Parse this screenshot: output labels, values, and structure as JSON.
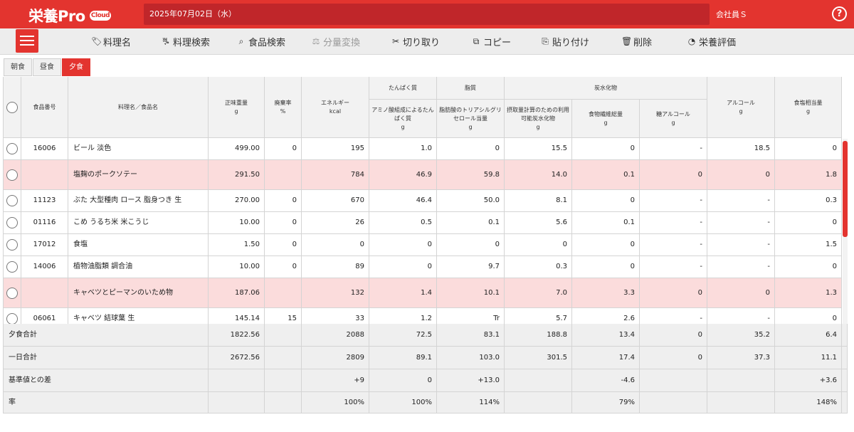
{
  "app": {
    "name": "栄養Pro",
    "cloud": "Cloud",
    "date": "2025年07月02日（水）",
    "user": "会社員Ｓ",
    "help": "?"
  },
  "toolbar": [
    {
      "label": "料理名",
      "icon": "tag-icon",
      "glyph": "🏷",
      "disabled": false
    },
    {
      "label": "料理検索",
      "icon": "cutlery-icon",
      "glyph": "ꔨ",
      "disabled": false
    },
    {
      "label": "食品検索",
      "icon": "search-icon",
      "glyph": "⌕",
      "disabled": false
    },
    {
      "label": "分量変換",
      "icon": "scale-icon",
      "glyph": "⚖",
      "disabled": true
    },
    {
      "label": "切り取り",
      "icon": "scissors-icon",
      "glyph": "✂",
      "disabled": false
    },
    {
      "label": "コピー",
      "icon": "copy-icon",
      "glyph": "⧉",
      "disabled": false
    },
    {
      "label": "貼り付け",
      "icon": "paste-icon",
      "glyph": "⎘",
      "disabled": false
    },
    {
      "label": "削除",
      "icon": "trash-icon",
      "glyph": "🗑",
      "disabled": false
    },
    {
      "label": "栄養評価",
      "icon": "pie-chart-icon",
      "glyph": "◔",
      "disabled": false
    }
  ],
  "tabs": [
    {
      "label": "朝食",
      "active": false
    },
    {
      "label": "昼食",
      "active": false
    },
    {
      "label": "夕食",
      "active": true
    }
  ],
  "headers": {
    "food_no": "食品番号",
    "name": "料理名／食品名",
    "weight": "正味重量",
    "weight_unit": "g",
    "waste": "廃棄率",
    "waste_unit": "%",
    "energy": "エネルギー",
    "energy_unit": "kcal",
    "protein_group": "たんぱく質",
    "protein": "アミノ酸組成によるたんぱく質",
    "protein_unit": "g",
    "fat_group": "脂質",
    "fat": "脂肪酸のトリアシルグリセロール当量",
    "fat_unit": "g",
    "carb_group": "炭水化物",
    "carb": "摂取量計算のための利用可能炭水化物",
    "carb_unit": "g",
    "fiber": "食物繊維総量",
    "fiber_unit": "g",
    "sugar_alcohol": "糖アルコール",
    "sugar_alcohol_unit": "g",
    "alcohol": "アルコール",
    "alcohol_unit": "g",
    "salt": "食塩相当量",
    "salt_unit": "g"
  },
  "rows": [
    {
      "dish": false,
      "no": "16006",
      "name": "ビール 淡色",
      "weight": "499.00",
      "waste": "0",
      "energy": "195",
      "protein": "1.0",
      "fat": "0",
      "carb": "15.5",
      "fiber": "0",
      "sugar_alcohol": "-",
      "alcohol": "18.5",
      "salt": "0"
    },
    {
      "dish": true,
      "no": "",
      "name": "塩麹のポークソテー",
      "weight": "291.50",
      "waste": "",
      "energy": "784",
      "protein": "46.9",
      "fat": "59.8",
      "carb": "14.0",
      "fiber": "0.1",
      "sugar_alcohol": "0",
      "alcohol": "0",
      "salt": "1.8"
    },
    {
      "dish": false,
      "no": "11123",
      "name": "ぶた 大型種肉 ロース 脂身つき 生",
      "weight": "270.00",
      "waste": "0",
      "energy": "670",
      "protein": "46.4",
      "fat": "50.0",
      "carb": "8.1",
      "fiber": "0",
      "sugar_alcohol": "-",
      "alcohol": "-",
      "salt": "0.3"
    },
    {
      "dish": false,
      "no": "01116",
      "name": "こめ うるち米 米こうじ",
      "weight": "10.00",
      "waste": "0",
      "energy": "26",
      "protein": "0.5",
      "fat": "0.1",
      "carb": "5.6",
      "fiber": "0.1",
      "sugar_alcohol": "-",
      "alcohol": "-",
      "salt": "0"
    },
    {
      "dish": false,
      "no": "17012",
      "name": "食塩",
      "weight": "1.50",
      "waste": "0",
      "energy": "0",
      "protein": "0",
      "fat": "0",
      "carb": "0",
      "fiber": "0",
      "sugar_alcohol": "-",
      "alcohol": "-",
      "salt": "1.5"
    },
    {
      "dish": false,
      "no": "14006",
      "name": "植物油脂類 調合油",
      "weight": "10.00",
      "waste": "0",
      "energy": "89",
      "protein": "0",
      "fat": "9.7",
      "carb": "0.3",
      "fiber": "0",
      "sugar_alcohol": "-",
      "alcohol": "-",
      "salt": "0"
    },
    {
      "dish": true,
      "no": "",
      "name": "キャベツとピーマンのいため物",
      "weight": "187.06",
      "waste": "",
      "energy": "132",
      "protein": "1.4",
      "fat": "10.1",
      "carb": "7.0",
      "fiber": "3.3",
      "sugar_alcohol": "0",
      "alcohol": "0",
      "salt": "1.3"
    },
    {
      "dish": false,
      "no": "06061",
      "name": "キャベツ 結球葉 生",
      "weight": "145.14",
      "waste": "15",
      "energy": "33",
      "protein": "1.2",
      "fat": "Tr",
      "carb": "5.7",
      "fiber": "2.6",
      "sugar_alcohol": "-",
      "alcohol": "-",
      "salt": "0"
    }
  ],
  "footer": [
    {
      "label": "夕食合計",
      "weight": "1822.56",
      "energy": "2088",
      "protein": "72.5",
      "fat": "83.1",
      "carb": "188.8",
      "fiber": "13.4",
      "sugar_alcohol": "0",
      "alcohol": "35.2",
      "salt": "6.4"
    },
    {
      "label": "一日合計",
      "weight": "2672.56",
      "energy": "2809",
      "protein": "89.1",
      "fat": "103.0",
      "carb": "301.5",
      "fiber": "17.4",
      "sugar_alcohol": "0",
      "alcohol": "37.3",
      "salt": "11.1"
    },
    {
      "label": "基準値との差",
      "weight": "",
      "energy": "+9",
      "protein": "0",
      "fat": "+13.0",
      "carb": "",
      "fiber": "-4.6",
      "sugar_alcohol": "",
      "alcohol": "",
      "salt": "+3.6"
    },
    {
      "label": "率",
      "weight": "",
      "energy": "100%",
      "protein": "100%",
      "fat": "114%",
      "carb": "",
      "fiber": "79%",
      "sugar_alcohol": "",
      "alcohol": "",
      "salt": "148%"
    }
  ],
  "colors": {
    "accent": "#e3342f",
    "dish_row": "#fbdcdc",
    "header_bg": "#f2f2f2"
  }
}
